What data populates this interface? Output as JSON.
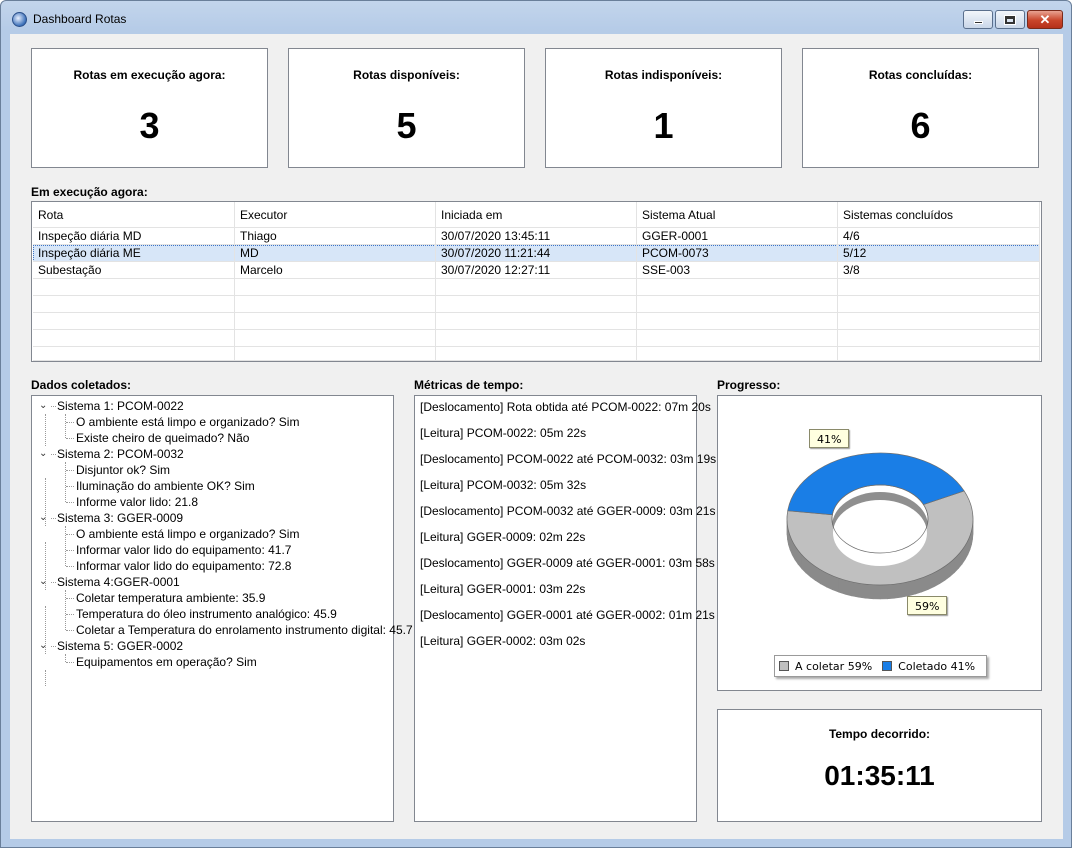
{
  "window": {
    "title": "Dashboard Rotas"
  },
  "cards": [
    {
      "label": "Rotas em execução agora:",
      "value": "3"
    },
    {
      "label": "Rotas disponíveis:",
      "value": "5"
    },
    {
      "label": "Rotas indisponíveis:",
      "value": "1"
    },
    {
      "label": "Rotas concluídas:",
      "value": "6"
    }
  ],
  "running": {
    "label": "Em execução agora:",
    "columns": [
      "Rota",
      "Executor",
      "Iniciada em",
      "Sistema Atual",
      "Sistemas concluídos"
    ],
    "rows": [
      [
        "Inspeção diária MD",
        "Thiago",
        "30/07/2020 13:45:11",
        "GGER-0001",
        "4/6"
      ],
      [
        "Inspeção diária ME",
        "MD",
        "30/07/2020 11:21:44",
        "PCOM-0073",
        "5/12"
      ],
      [
        "Subestação",
        "Marcelo",
        "30/07/2020 12:27:11",
        "SSE-003",
        "3/8"
      ]
    ],
    "selected_row": 1
  },
  "collected": {
    "label": "Dados coletados:",
    "systems": [
      {
        "name": "Sistema 1: PCOM-0022",
        "items": [
          "O ambiente está limpo e organizado? Sim",
          "Existe cheiro de queimado? Não"
        ]
      },
      {
        "name": "Sistema 2: PCOM-0032",
        "items": [
          "Disjuntor ok? Sim",
          "Iluminação do ambiente OK? Sim",
          "Informe valor lido: 21.8"
        ]
      },
      {
        "name": "Sistema 3: GGER-0009",
        "items": [
          "O ambiente está limpo e organizado? Sim",
          "Informar valor lido do equipamento: 41.7",
          "Informar valor lido do equipamento: 72.8"
        ]
      },
      {
        "name": "Sistema 4:GGER-0001",
        "items": [
          "Coletar temperatura ambiente: 35.9",
          "Temperatura do óleo instrumento analógico: 45.9",
          "Coletar a Temperatura do enrolamento  instrumento digital: 45.7"
        ]
      },
      {
        "name": "Sistema 5: GGER-0002",
        "items": [
          "Equipamentos em operação? Sim"
        ]
      }
    ]
  },
  "metrics": {
    "label": "Métricas de tempo:",
    "lines": [
      "[Deslocamento] Rota obtida até PCOM-0022: 07m 20s",
      "[Leitura] PCOM-0022: 05m 22s",
      "[Deslocamento] PCOM-0022 até PCOM-0032: 03m 19s",
      "[Leitura] PCOM-0032: 05m 32s",
      "[Deslocamento] PCOM-0032 até GGER-0009: 03m 21s",
      "[Leitura] GGER-0009: 02m 22s",
      "[Deslocamento]  GGER-0009 até GGER-0001: 03m 58s",
      "[Leitura] GGER-0001: 03m 22s",
      "[Deslocamento]  GGER-0001 até GGER-0002: 01m 21s",
      "[Leitura] GGER-0002: 03m 02s"
    ]
  },
  "progress": {
    "label": "Progresso:",
    "chart_data": {
      "type": "pie",
      "style": "doughnut-3d",
      "categories": [
        "A coletar",
        "Coletado"
      ],
      "values": [
        59,
        41
      ],
      "data_labels": [
        "59%",
        "41%"
      ],
      "legend_labels": [
        "A coletar 59%",
        "Coletado 41%"
      ],
      "colors": [
        "#c0c0c0",
        "#1a7ee6"
      ],
      "legend_position": "bottom"
    }
  },
  "elapsed": {
    "label": "Tempo decorrido:",
    "value": "01:35:11"
  }
}
